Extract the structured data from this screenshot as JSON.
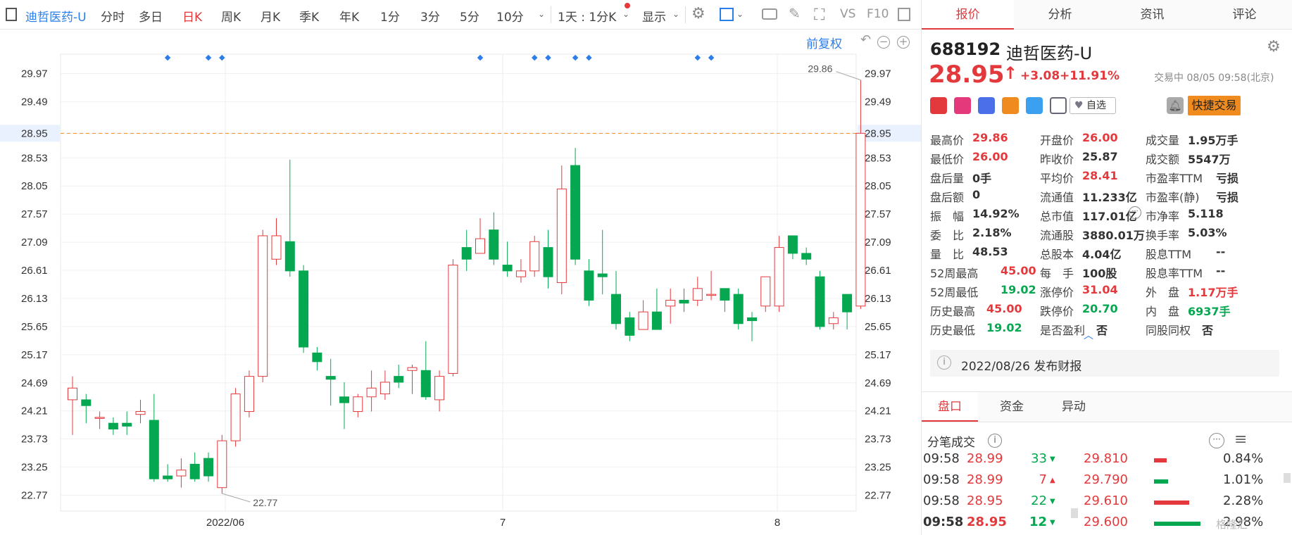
{
  "toolbar": {
    "stock_link": "迪哲医药-U",
    "items": [
      "分时",
      "多日",
      "日K",
      "周K",
      "月K",
      "季K",
      "年K",
      "1分",
      "3分",
      "5分",
      "10分"
    ],
    "active": "日K",
    "interval": "1天 : 1分K",
    "display": "显示",
    "vs": "VS",
    "f10": "F10"
  },
  "chart_top": {
    "restore_label": "前复权"
  },
  "chart_data": {
    "type": "candlestick",
    "yticks": [
      "29.97",
      "29.49",
      "28.95",
      "28.53",
      "28.05",
      "27.57",
      "27.09",
      "26.61",
      "26.13",
      "25.65",
      "25.17",
      "24.69",
      "24.21",
      "23.73",
      "23.25",
      "22.77"
    ],
    "xlabels": [
      "2022/06",
      "7",
      "8"
    ],
    "current_price": "28.95",
    "max_label": "29.86",
    "min_label": "22.77",
    "candles": [
      [
        24.4,
        24.6,
        24.8,
        23.8
      ],
      [
        24.4,
        24.3,
        24.5,
        24.0
      ],
      [
        24.1,
        24.1,
        24.2,
        23.9
      ],
      [
        24.0,
        23.9,
        24.1,
        23.8
      ],
      [
        24.0,
        23.95,
        24.2,
        23.8
      ],
      [
        24.15,
        24.2,
        24.4,
        24.0
      ],
      [
        24.05,
        23.05,
        24.5,
        23.0
      ],
      [
        23.1,
        23.05,
        23.3,
        23.0
      ],
      [
        23.1,
        23.2,
        23.4,
        22.9
      ],
      [
        23.3,
        23.05,
        23.5,
        23.0
      ],
      [
        23.4,
        23.1,
        23.5,
        23.0
      ],
      [
        22.9,
        23.7,
        23.8,
        22.8
      ],
      [
        23.7,
        24.5,
        24.6,
        23.6
      ],
      [
        24.2,
        24.8,
        24.9,
        24.1
      ],
      [
        24.8,
        27.2,
        27.3,
        24.7
      ],
      [
        26.8,
        27.2,
        27.5,
        26.7
      ],
      [
        27.1,
        26.6,
        28.5,
        26.5
      ],
      [
        26.6,
        25.3,
        26.7,
        25.2
      ],
      [
        25.2,
        25.05,
        25.3,
        24.9
      ],
      [
        24.8,
        24.75,
        25.1,
        24.3
      ],
      [
        24.45,
        24.35,
        24.7,
        23.9
      ],
      [
        24.2,
        24.45,
        24.5,
        24.1
      ],
      [
        24.45,
        24.6,
        24.9,
        24.2
      ],
      [
        24.5,
        24.7,
        24.9,
        24.4
      ],
      [
        24.8,
        24.7,
        25.0,
        24.6
      ],
      [
        24.9,
        24.95,
        25.0,
        24.5
      ],
      [
        24.9,
        24.45,
        25.4,
        24.4
      ],
      [
        24.4,
        24.8,
        24.9,
        24.2
      ],
      [
        24.85,
        26.7,
        26.8,
        24.8
      ],
      [
        27.0,
        26.8,
        27.3,
        26.6
      ],
      [
        26.9,
        27.15,
        27.5,
        26.9
      ],
      [
        27.3,
        26.8,
        27.6,
        26.7
      ],
      [
        26.7,
        26.6,
        27.1,
        26.5
      ],
      [
        26.5,
        26.6,
        26.8,
        26.4
      ],
      [
        26.6,
        27.1,
        27.2,
        26.5
      ],
      [
        27.0,
        26.5,
        27.3,
        26.3
      ],
      [
        26.4,
        28.0,
        28.4,
        26.2
      ],
      [
        28.4,
        26.8,
        28.7,
        26.7
      ],
      [
        26.6,
        26.1,
        26.8,
        26.0
      ],
      [
        26.55,
        26.5,
        27.3,
        26.2
      ],
      [
        26.2,
        25.7,
        26.6,
        25.6
      ],
      [
        25.8,
        25.5,
        25.9,
        25.4
      ],
      [
        25.6,
        25.9,
        26.1,
        25.6
      ],
      [
        25.9,
        25.6,
        26.3,
        25.6
      ],
      [
        26.0,
        26.1,
        26.3,
        25.7
      ],
      [
        26.1,
        26.05,
        26.3,
        25.9
      ],
      [
        26.1,
        26.3,
        26.5,
        26.0
      ],
      [
        26.2,
        26.2,
        26.6,
        26.1
      ],
      [
        26.3,
        26.1,
        26.3,
        25.9
      ],
      [
        26.2,
        25.7,
        26.3,
        25.6
      ],
      [
        25.8,
        25.75,
        25.9,
        25.4
      ],
      [
        26.0,
        26.5,
        26.5,
        25.9
      ],
      [
        26.0,
        27.0,
        27.2,
        25.9
      ],
      [
        27.2,
        26.9,
        27.2,
        26.8
      ],
      [
        26.9,
        26.8,
        27.0,
        26.7
      ],
      [
        26.5,
        25.65,
        26.6,
        25.6
      ],
      [
        25.7,
        25.8,
        25.9,
        25.6
      ],
      [
        26.2,
        25.9,
        26.2,
        25.6
      ],
      [
        26.0,
        28.95,
        29.86,
        25.95
      ]
    ]
  },
  "stock": {
    "code": "688192",
    "name": "迪哲医药-U",
    "price": "28.95",
    "arrow": "↑",
    "change": "+3.08",
    "pct": "+11.91%",
    "status": "交易中 08/05 09:58(北京)",
    "watch": "自选",
    "trade_btn": "快捷交易"
  },
  "quotes": [
    [
      {
        "l": "最高价",
        "v": "29.86",
        "c": "red"
      },
      {
        "l": "开盘价",
        "v": "26.00",
        "c": "red"
      },
      {
        "l": "成交量",
        "v": "1.95万手",
        "c": ""
      }
    ],
    [
      {
        "l": "最低价",
        "v": "26.00",
        "c": "red"
      },
      {
        "l": "昨收价",
        "v": "25.87",
        "c": ""
      },
      {
        "l": "成交额",
        "v": "5547万",
        "c": ""
      }
    ],
    [
      {
        "l": "盘后量",
        "v": "0手",
        "c": ""
      },
      {
        "l": "平均价",
        "v": "28.41",
        "c": "red"
      },
      {
        "l": "市盈率TTM",
        "v": "亏损",
        "c": ""
      }
    ],
    [
      {
        "l": "盘后额",
        "v": "0",
        "c": ""
      },
      {
        "l": "流通值",
        "v": "11.233亿",
        "c": ""
      },
      {
        "l": "市盈率(静)",
        "v": "亏损",
        "c": ""
      }
    ],
    [
      {
        "l": "振　幅",
        "v": "14.92%",
        "c": ""
      },
      {
        "l": "总市值",
        "v": "117.01亿",
        "c": ""
      },
      {
        "l": "市净率",
        "v": "5.118",
        "c": ""
      }
    ],
    [
      {
        "l": "委　比",
        "v": "2.18%",
        "c": ""
      },
      {
        "l": "流通股",
        "v": "3880.01万",
        "c": ""
      },
      {
        "l": "换手率",
        "v": "5.03%",
        "c": ""
      }
    ],
    [
      {
        "l": "量　比",
        "v": "48.53",
        "c": ""
      },
      {
        "l": "总股本",
        "v": "4.04亿",
        "c": ""
      },
      {
        "l": "股息TTM",
        "v": "--",
        "c": ""
      }
    ],
    [
      {
        "l": "52周最高",
        "v": "45.00",
        "c": "red"
      },
      {
        "l": "每　手",
        "v": "100股",
        "c": ""
      },
      {
        "l": "股息率TTM",
        "v": "--",
        "c": ""
      }
    ],
    [
      {
        "l": "52周最低",
        "v": "19.02",
        "c": "green"
      },
      {
        "l": "涨停价",
        "v": "31.04",
        "c": "red"
      },
      {
        "l": "外　盘",
        "v": "1.17万手",
        "c": "red"
      }
    ],
    [
      {
        "l": "历史最高",
        "v": "45.00",
        "c": "red"
      },
      {
        "l": "跌停价",
        "v": "20.70",
        "c": "green"
      },
      {
        "l": "内　盘",
        "v": "6937手",
        "c": "green"
      }
    ],
    [
      {
        "l": "历史最低",
        "v": "19.02",
        "c": "green"
      },
      {
        "l": "是否盈利",
        "v": "否",
        "c": ""
      },
      {
        "l": "同股同权",
        "v": "否",
        "c": ""
      }
    ]
  ],
  "report": {
    "text": "2022/08/26  发布财报"
  },
  "right_tabs": [
    "报价",
    "分析",
    "资讯",
    "评论"
  ],
  "bottom_tabs": [
    "盘口",
    "资金",
    "异动"
  ],
  "tick": {
    "title": "分笔成交",
    "rows": [
      {
        "t": "09:58",
        "p": "28.99",
        "v": "33",
        "dir": "down"
      },
      {
        "t": "09:58",
        "p": "28.99",
        "v": "7",
        "dir": "up"
      },
      {
        "t": "09:58",
        "p": "28.95",
        "v": "22",
        "dir": "down"
      },
      {
        "t": "09:58",
        "p": "28.95",
        "v": "12",
        "dir": "down"
      }
    ],
    "dist": [
      {
        "p": "29.810",
        "pct": "0.84%",
        "bar": 0.15,
        "col": "#e4393c"
      },
      {
        "p": "29.790",
        "pct": "1.01%",
        "bar": 0.17,
        "col": "#05a850"
      },
      {
        "p": "29.610",
        "pct": "2.28%",
        "bar": 0.42,
        "col": "#e4393c"
      },
      {
        "p": "29.600",
        "pct": "2.98%",
        "bar": 0.55,
        "col": "#05a850"
      }
    ]
  },
  "watermark": "格隆汇"
}
